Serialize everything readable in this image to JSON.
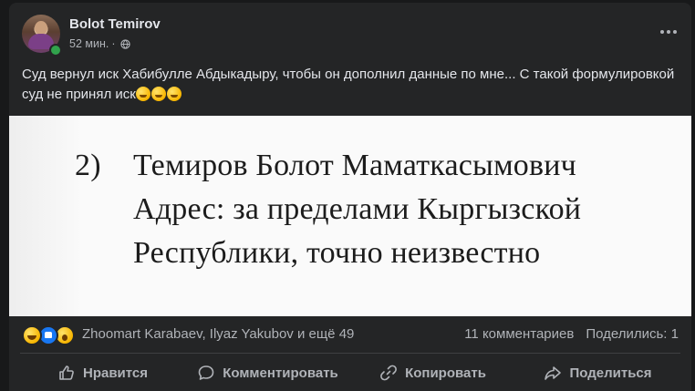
{
  "post": {
    "author": "Bolot Temirov",
    "time": "52 мин.",
    "meta_separator": "·",
    "audience_icon": "globe-icon",
    "more_icon": "more-horizontal-icon",
    "text": "Суд вернул иск Хабибулле Абдыкадыру, чтобы он дополнил данные по мне... С такой формулировкой суд не принял иск",
    "text_emojis": [
      "grinning-face-icon",
      "grimacing-face-icon",
      "astonished-face-icon"
    ]
  },
  "photo": {
    "number": "2)",
    "line1": "Темиров Болот Маматкасымович",
    "line2": "Адрес: за пределами Кыргызской",
    "line3": "Республики, точно неизвестно"
  },
  "reactions": {
    "icons": [
      "haha-reaction-icon",
      "like-reaction-icon",
      "wow-reaction-icon"
    ],
    "reactors": "Zhoomart Karabaev, Ilyaz Yakubov и ещё 49",
    "comments": "11 комментариев",
    "shares": "Поделились: 1"
  },
  "actions": {
    "like": "Нравится",
    "comment": "Комментировать",
    "copy": "Копировать",
    "share": "Поделиться"
  },
  "colors": {
    "background": "#18191a",
    "card": "#242526",
    "text_primary": "#e4e6eb",
    "text_secondary": "#b0b3b8",
    "online": "#31a24c",
    "like_blue": "#1877f2"
  }
}
